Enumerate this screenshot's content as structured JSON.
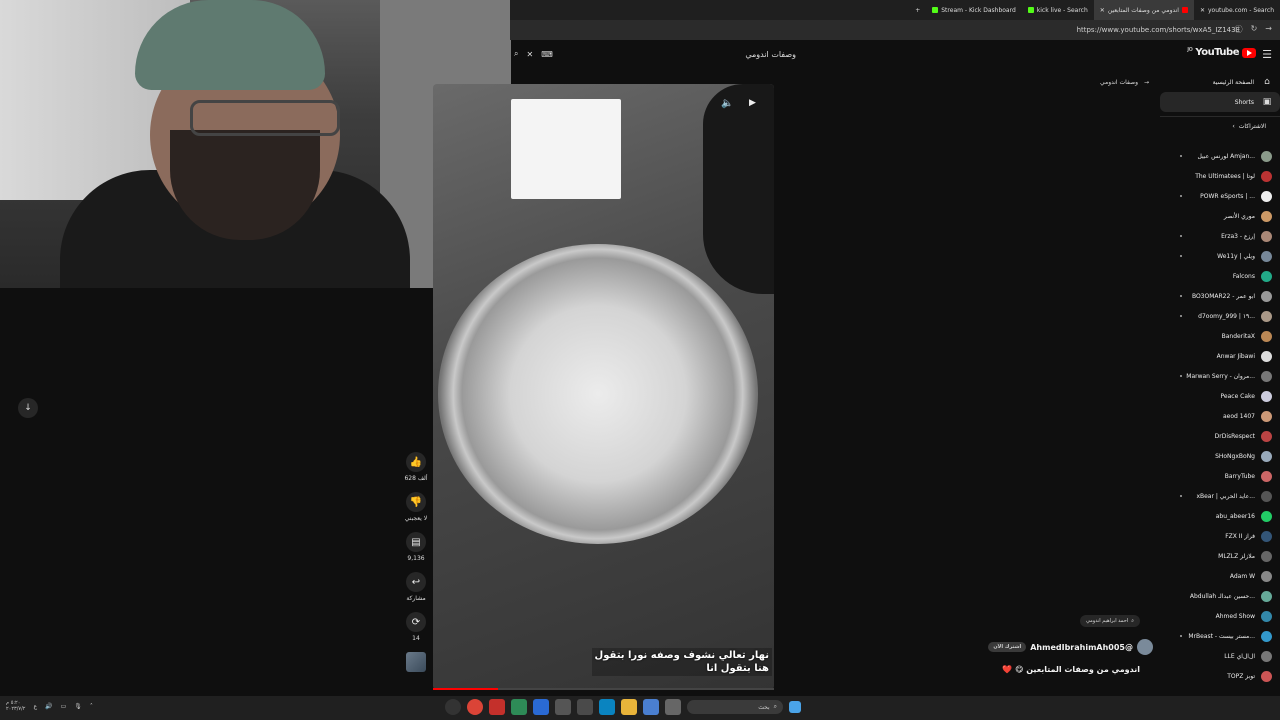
{
  "browser": {
    "tabs": [
      {
        "label": "Stream - Kick Dashboard",
        "color": "#53fc18"
      },
      {
        "label": "kick live - Search",
        "color": "#53fc18"
      },
      {
        "label": "اندومي من وصفات المتابعين",
        "color": "#ff0000"
      },
      {
        "label": "youtube.com - Search",
        "color": "#4285f4"
      }
    ],
    "new_tab": "+",
    "url": "https://www.youtube.com/shorts/wxA5_IZ143E"
  },
  "header": {
    "search_value": "وصفات اندومي",
    "brand": "YouTube",
    "brand_suffix": "JO"
  },
  "breadcrumb": {
    "label": "وصفات اندومي"
  },
  "sidebar": {
    "items": [
      {
        "label": "الصفحة الرئيسية",
        "icon": "home-icon",
        "glyph": "⌂"
      },
      {
        "label": "Shorts",
        "icon": "shorts-icon",
        "glyph": "▣"
      }
    ],
    "subscriptions_header": "الاشتراكات"
  },
  "subscriptions": [
    {
      "label": "لورنس عبيل Amjan...",
      "color": "#8a9a8a",
      "dot": true
    },
    {
      "label": "The Ultimatees | لوتا",
      "color": "#b33",
      "dot": false
    },
    {
      "label": "POWR eSports | ...",
      "color": "#eee",
      "dot": true
    },
    {
      "label": "موري الأنصر",
      "color": "#c96",
      "dot": false
    },
    {
      "label": "Erza3 - إرزع",
      "color": "#a87",
      "dot": true
    },
    {
      "label": "We11y | ويلي",
      "color": "#789",
      "dot": true
    },
    {
      "label": "Falcons",
      "color": "#2a8",
      "dot": false
    },
    {
      "label": "BO3OMAR22 - ابو عمر",
      "color": "#999",
      "dot": true
    },
    {
      "label": "d7oomy_999 | ١٩...",
      "color": "#a98",
      "dot": true
    },
    {
      "label": "BanderitaX",
      "color": "#b85",
      "dot": false
    },
    {
      "label": "Anwar Jibawi",
      "color": "#ddd",
      "dot": false
    },
    {
      "label": "Marwan Serry - مروان...",
      "color": "#777",
      "dot": true
    },
    {
      "label": "Peace Cake",
      "color": "#ccd",
      "dot": false
    },
    {
      "label": "aeod 1407",
      "color": "#c97",
      "dot": false
    },
    {
      "label": "DrDisRespect",
      "color": "#b44",
      "dot": false
    },
    {
      "label": "SHoNgxBoNg",
      "color": "#9ab",
      "dot": false
    },
    {
      "label": "BarryTube",
      "color": "#c66",
      "dot": false
    },
    {
      "label": "xBear | عايد الحربي...",
      "color": "#555",
      "dot": true
    },
    {
      "label": "abu_abeer16",
      "color": "#2c6",
      "dot": false
    },
    {
      "label": "FZX II فراز",
      "color": "#357",
      "dot": false
    },
    {
      "label": "MLZLZ ملازلز",
      "color": "#666",
      "dot": false
    },
    {
      "label": "Adam W",
      "color": "#888",
      "dot": false
    },
    {
      "label": "Abdullah حسين عبدالـ...",
      "color": "#6a9",
      "dot": false
    },
    {
      "label": "Ahmed Show",
      "color": "#38a",
      "dot": false
    },
    {
      "label": "MrBeast - مستر بيست...",
      "color": "#39c",
      "dot": true
    },
    {
      "label": "LLE ال‌ال‌اي",
      "color": "#777",
      "dot": false
    },
    {
      "label": "TOPZ توبز",
      "color": "#c55",
      "dot": false
    }
  ],
  "video": {
    "caption_line1": "نهار تعالي نشوف وصفه نورا بتقول",
    "caption_line2": "هنا بتقول انا",
    "progress": 0.19
  },
  "actions": {
    "like_count": "628 ألف",
    "dislike_label": "لا يعجبني",
    "comment_count": "9,136",
    "share_label": "مشاركة",
    "remix_count": "14"
  },
  "meta": {
    "tag": "احمد ابراهيم اندومي",
    "channel": "@AhmedIbrahimAh005",
    "subscribe": "اشترك الآن",
    "title": "اندومي من وصفات المتابعين 😋 ❤️"
  },
  "taskbar": {
    "time": "٥:٢٠ م",
    "date": "٢٠٢٣/٧/٢",
    "search_placeholder": "بحث"
  }
}
